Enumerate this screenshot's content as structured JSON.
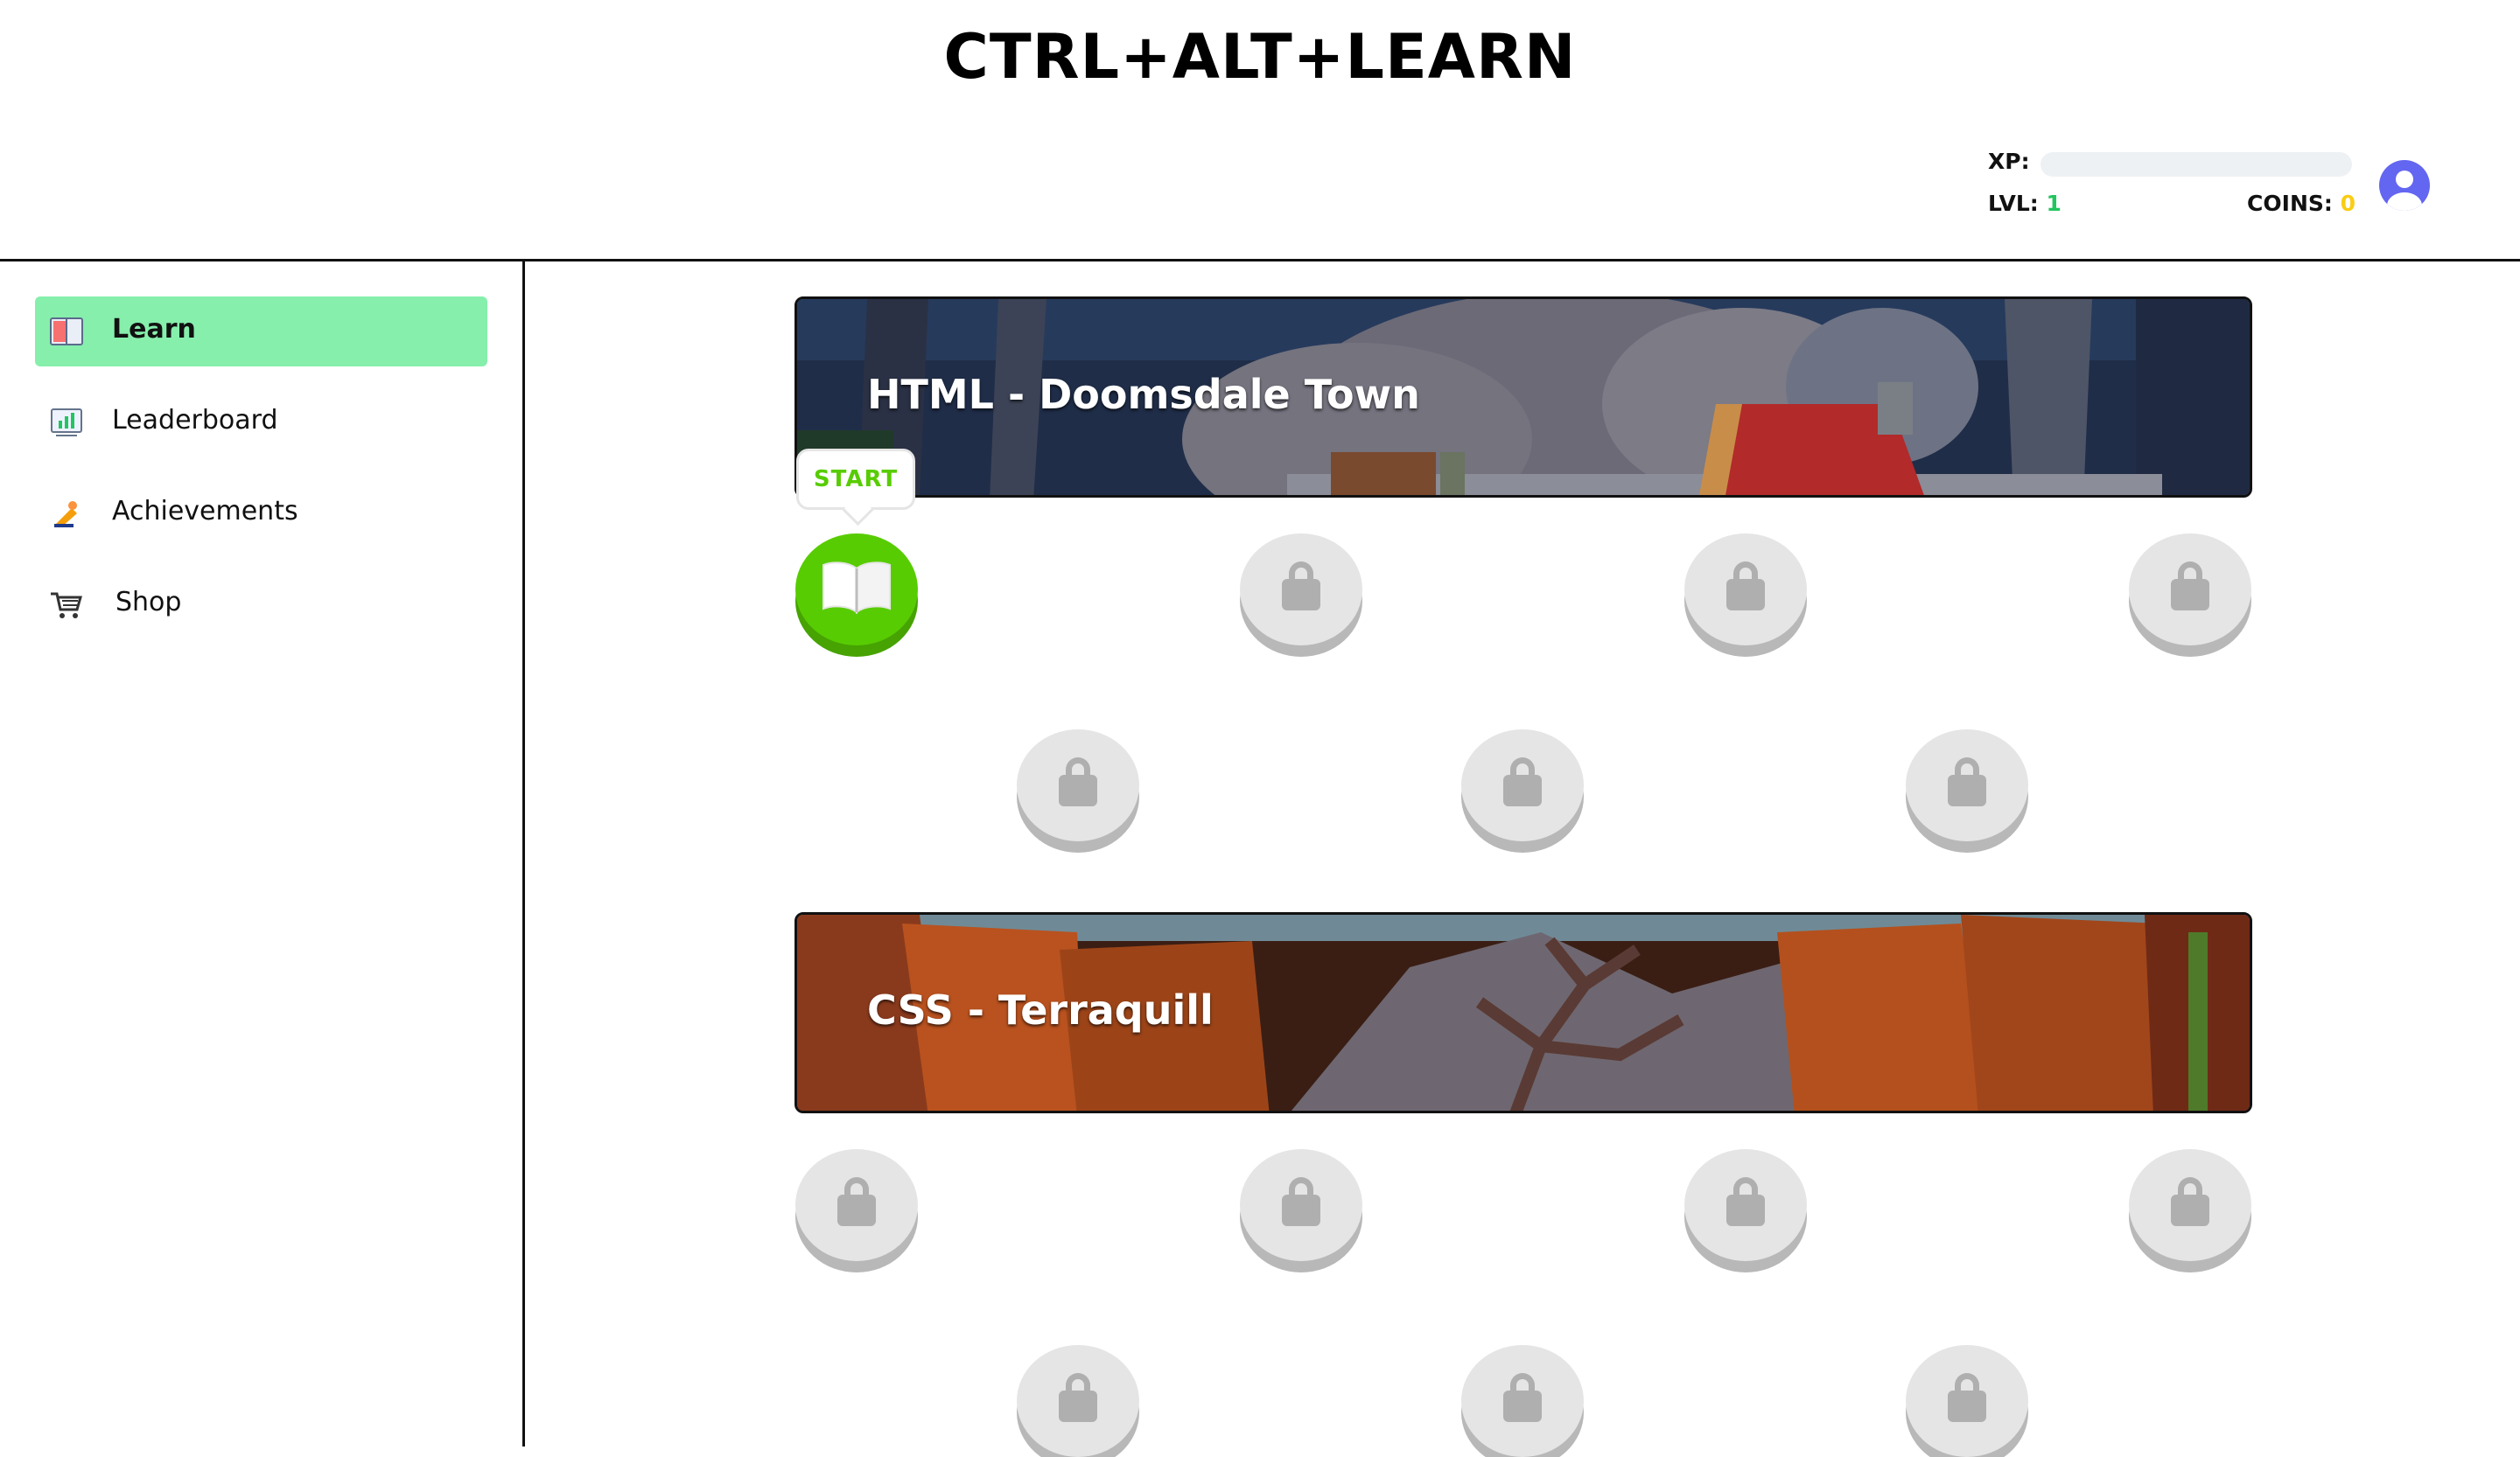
{
  "header": {
    "title": "CTRL+ALT+LEARN",
    "xp_label": "XP:",
    "xp_progress": 0,
    "lvl_label": "LVL:",
    "lvl_value": "1",
    "coins_label": "COINS:",
    "coins_value": "0"
  },
  "sidebar": {
    "items": [
      {
        "label": "Learn",
        "icon": "book-icon",
        "active": true
      },
      {
        "label": "Leaderboard",
        "icon": "chart-icon",
        "active": false
      },
      {
        "label": "Achievements",
        "icon": "trophy-icon",
        "active": false
      },
      {
        "label": "Shop",
        "icon": "cart-icon",
        "active": false
      }
    ]
  },
  "units": [
    {
      "title": "HTML - Doomsdale Town",
      "start_label": "START",
      "lessons": [
        "open",
        "locked",
        "locked",
        "locked",
        "locked",
        "locked",
        "locked"
      ]
    },
    {
      "title": "CSS - Terraquill",
      "lessons": [
        "locked",
        "locked",
        "locked",
        "locked",
        "locked",
        "locked",
        "locked"
      ]
    }
  ],
  "colors": {
    "accent_green": "#86efac",
    "start_green": "#58cc02",
    "level_green": "#22c55e",
    "coins_yellow": "#facc15",
    "avatar_purple": "#6366f1"
  }
}
